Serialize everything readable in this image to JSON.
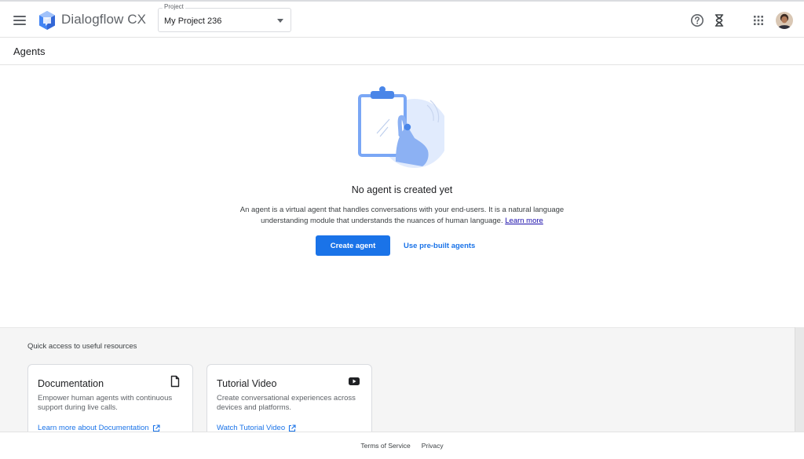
{
  "header": {
    "app_name": "Dialogflow CX",
    "project_label": "Project",
    "project_value": "My Project 236",
    "icons": [
      "menu-icon",
      "dialogflow-logo",
      "help-icon",
      "hourglass-icon",
      "apps-grid-icon",
      "avatar"
    ]
  },
  "page": {
    "title": "Agents"
  },
  "empty_state": {
    "title": "No agent is created yet",
    "description": "An agent is a virtual agent that handles conversations with your end-users. It is a natural language understanding module that understands the nuances of human language.",
    "learn_more": "Learn more",
    "create_button": "Create agent",
    "prebuilt_button": "Use pre-built agents"
  },
  "resources": {
    "heading": "Quick access to useful resources",
    "cards": [
      {
        "title": "Documentation",
        "description": "Empower human agents with continuous support during live calls.",
        "link": "Learn more about Documentation",
        "icon": "document-icon"
      },
      {
        "title": "Tutorial Video",
        "description": "Create conversational experiences across devices and platforms.",
        "link": "Watch Tutorial Video",
        "icon": "youtube-icon"
      }
    ]
  },
  "footer": {
    "terms": "Terms of Service",
    "privacy": "Privacy"
  },
  "colors": {
    "primary": "#1a73e8",
    "link_visited": "#1a0dab",
    "resources_bg": "#f5f5f5"
  }
}
